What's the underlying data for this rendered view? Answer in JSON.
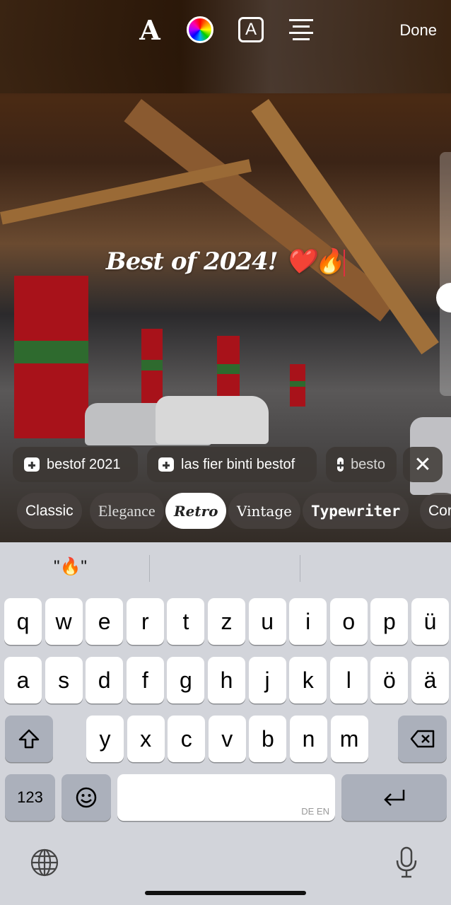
{
  "toolbar": {
    "font_icon": "font-style-icon",
    "color_icon": "color-wheel-icon",
    "background_icon": "text-background-icon",
    "align_icon": "align-center-icon",
    "done_label": "Done"
  },
  "caption": {
    "text": "Best of 2024! ❤️🔥"
  },
  "hashtag_suggestions": [
    {
      "label": "bestof 2021"
    },
    {
      "label": "las fier binti bestof"
    },
    {
      "label": "besto"
    }
  ],
  "fonts": [
    {
      "label": "Classic"
    },
    {
      "label": "Elegance"
    },
    {
      "label": "Retro",
      "selected": true
    },
    {
      "label": "Vintage"
    },
    {
      "label": "Typewriter"
    },
    {
      "label": "Cor"
    }
  ],
  "keyboard": {
    "suggestion": "\"🔥\"",
    "row1": [
      "q",
      "w",
      "e",
      "r",
      "t",
      "z",
      "u",
      "i",
      "o",
      "p",
      "ü"
    ],
    "row2": [
      "a",
      "s",
      "d",
      "f",
      "g",
      "h",
      "j",
      "k",
      "l",
      "ö",
      "ä"
    ],
    "row3": [
      "y",
      "x",
      "c",
      "v",
      "b",
      "n",
      "m"
    ],
    "numbers_label": "123",
    "language_label": "DE EN"
  }
}
